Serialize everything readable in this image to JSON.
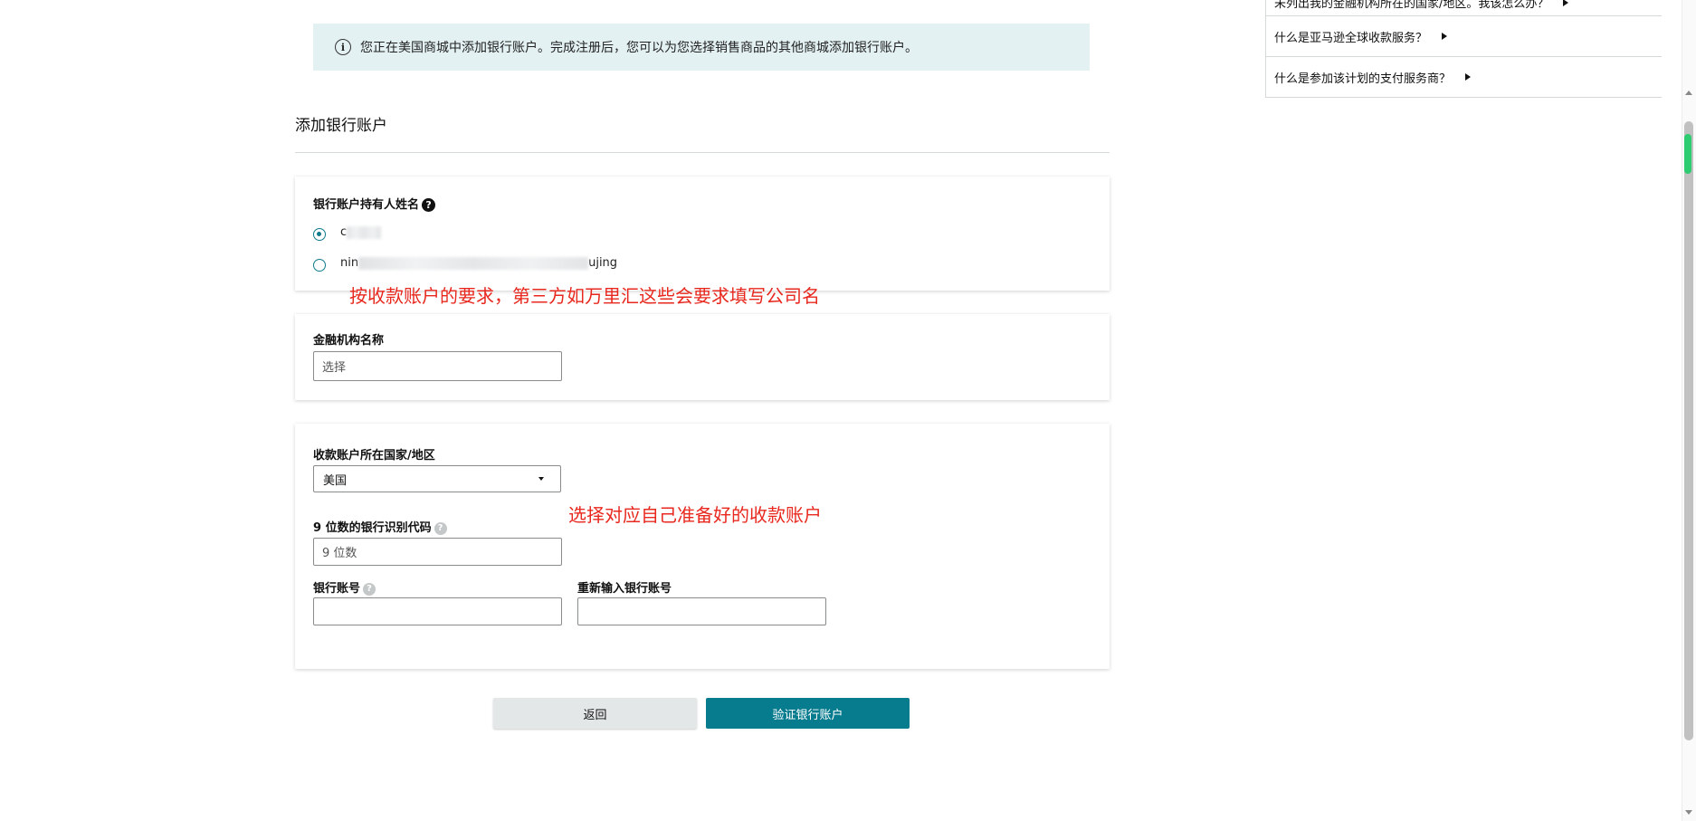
{
  "banner": {
    "icon": "info-icon",
    "text": "您正在美国商城中添加银行账户。完成注册后，您可以为您选择销售商品的其他商城添加银行账户。"
  },
  "section": {
    "title": "添加银行账户"
  },
  "holder": {
    "label": "银行账户持有人姓名",
    "help_icon": "question-icon",
    "options": [
      {
        "prefix": "c",
        "suffix": "",
        "selected": true
      },
      {
        "prefix": "nin",
        "suffix": "ujing",
        "selected": false
      }
    ]
  },
  "institution": {
    "label": "金融机构名称",
    "placeholder": "选择"
  },
  "country": {
    "label": "收款账户所在国家/地区",
    "selected": "美国"
  },
  "routing": {
    "label": "9 位数的银行识别代码",
    "placeholder": "9 位数"
  },
  "account": {
    "label": "银行账号",
    "confirm_label": "重新输入银行账号"
  },
  "annotations": {
    "holder_note": "按收款账户的要求，第三方如万里汇这些会要求填写公司名",
    "account_note": "选择对应自己准备好的收款账户"
  },
  "buttons": {
    "back": "返回",
    "verify": "验证银行账户"
  },
  "faq": [
    "未列出我的金融机构所在的国家/地区。我该怎么办？",
    "什么是亚马逊全球收款服务？",
    "什么是参加该计划的支付服务商？"
  ],
  "colors": {
    "primary": "#087c8f",
    "banner_bg": "#e3f1f3",
    "annotation": "#e8281e"
  }
}
